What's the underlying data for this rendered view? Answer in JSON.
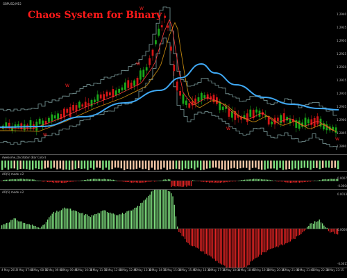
{
  "chart_title": "Chaos System for Binary",
  "main_pane": {
    "symbol_label": "GBPUSD,M15",
    "price_scale": [
      "1.2940",
      "1.2935",
      "1.2930",
      "1.2925",
      "1.2920",
      "1.2915",
      "1.2910",
      "1.2905",
      "1.2900",
      "1.2895",
      "1.2890"
    ]
  },
  "panes": [
    {
      "label": "Awesome_Oscillator (Bar Color)",
      "value": ""
    },
    {
      "label": "AO(5) mode ×2",
      "value": "0.0000"
    },
    {
      "label": "AO(5) mode ×2",
      "value": "0.0000"
    }
  ],
  "osc_scale_1": [
    "0.0007",
    "-0.0004"
  ],
  "osc_scale_2": [
    "0.0013",
    "0.0000",
    "-0.0011"
  ],
  "time_axis": [
    "4 May 2017",
    "8 May 07:45",
    "8 May 08:15",
    "8 May 09:00",
    "8 May 09:45",
    "8 May 10:30",
    "8 May 11:15",
    "8 May 12:00",
    "8 May 12:45",
    "8 May 13:30",
    "8 May 14:15",
    "8 May 15:00",
    "8 May 15:45",
    "8 May 16:30",
    "8 May 17:15",
    "8 May 18:00",
    "8 May 18:45",
    "8 May 19:30",
    "8 May 20:15",
    "8 May 21:00",
    "8 May 21:45",
    "8 May 22:30",
    "8 May 23:15"
  ],
  "colors": {
    "background": "#000000",
    "bull_candle": "#1aa81a",
    "bear_candle": "#d41616",
    "channel": "#7f9f9f",
    "ma_fast": "#ff3b3b",
    "ma_mid": "#c1860f",
    "ma_slow": "#3fa9f5",
    "osc_up": "#7fe07f",
    "osc_down": "#e02424",
    "bar_light": "#f5c9a8",
    "fractal": "#ff2020"
  },
  "fractal_markers": [
    "W",
    "W",
    "W",
    "W",
    "W",
    "W"
  ]
}
